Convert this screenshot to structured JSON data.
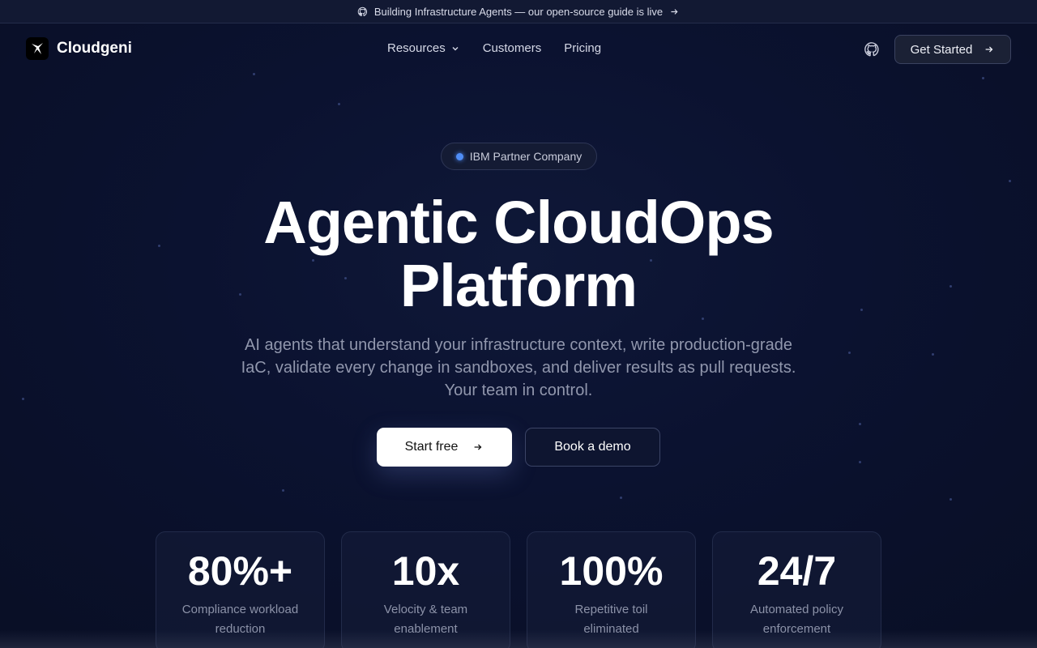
{
  "announcement": {
    "text": "Building Infrastructure Agents — our open-source guide is live",
    "icon": "github-icon"
  },
  "nav": {
    "brand": "Cloudgeni",
    "items": [
      {
        "label": "Resources",
        "has_dropdown": true
      },
      {
        "label": "Customers",
        "has_dropdown": false
      },
      {
        "label": "Pricing",
        "has_dropdown": false
      }
    ],
    "cta_label": "Get Started"
  },
  "hero": {
    "badge": "IBM Partner Company",
    "title_line1": "Agentic CloudOps",
    "title_line2": "Platform",
    "subtitle": "AI agents that understand your infrastructure context, write production-grade IaC, validate every change in sandboxes, and deliver results as pull requests. Your team in control.",
    "primary_button": "Start free",
    "secondary_button": "Book a demo"
  },
  "stats": [
    {
      "value": "80%+",
      "label": "Compliance workload reduction"
    },
    {
      "value": "10x",
      "label": "Velocity & team enablement"
    },
    {
      "value": "100%",
      "label": "Repetitive toil eliminated"
    },
    {
      "value": "24/7",
      "label": "Automated policy enforcement"
    }
  ],
  "colors": {
    "background": "#0b1230",
    "accent_dot": "#4f8df7",
    "primary_button_bg": "#ffffff"
  }
}
